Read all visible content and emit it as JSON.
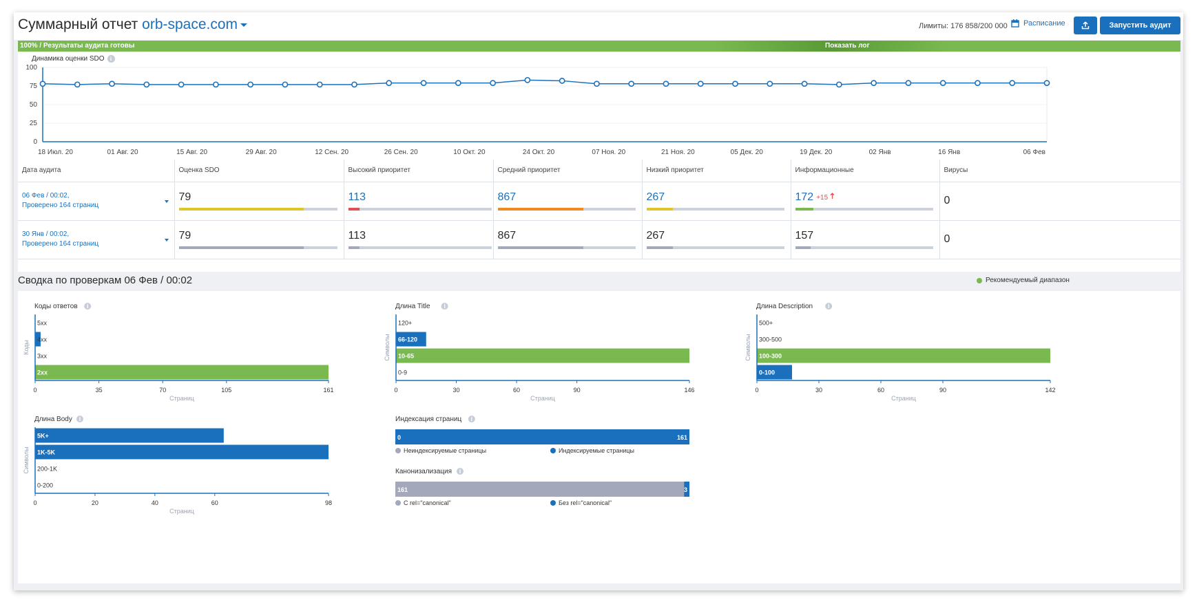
{
  "header": {
    "title": "Суммарный отчет",
    "domain": "orb-space.com",
    "limits": "Лимиты: 176 858/200 000",
    "schedule": "Расписание",
    "run_button": "Запустить аудит"
  },
  "progress": {
    "status": "100% / Результаты аудита готовы",
    "show_log": "Показать лог",
    "percent": 100
  },
  "colors": {
    "accent": "#1a70bd",
    "green": "#7ab94f",
    "yellow": "#e2c52a",
    "red": "#e05050",
    "orange": "#f08a1c",
    "grey": "#a3a9bb"
  },
  "sdo_chart": {
    "title": "Динамика оценки SDO",
    "y_ticks": [
      "100",
      "75",
      "50",
      "25",
      "0"
    ],
    "x_labels": [
      "18 Июл. 20",
      "01 Авг. 20",
      "15 Авг. 20",
      "29 Авг. 20",
      "12 Сен. 20",
      "26 Сен. 20",
      "10 Окт. 20",
      "24 Окт. 20",
      "07 Ноя. 20",
      "21 Ноя. 20",
      "05 Дек. 20",
      "19 Дек. 20",
      "02 Янв",
      "16 Янв",
      "06 Фев"
    ]
  },
  "audit_table": {
    "headers": [
      "Дата аудита",
      "Оценка SDO",
      "Высокий приоритет",
      "Средний приоритет",
      "Низкий приоритет",
      "Информационные",
      "Вирусы"
    ],
    "rows": [
      {
        "date_line1": "06 Фев / 00:02,",
        "date_line2": "Проверено 164 страниц",
        "sdo": "79",
        "high": "113",
        "medium": "867",
        "low": "267",
        "info": "172",
        "info_delta": "+15",
        "viruses": "0"
      },
      {
        "date_line1": "30 Янв / 00:02,",
        "date_line2": "Проверено 164 страниц",
        "sdo": "79",
        "high": "113",
        "medium": "867",
        "low": "267",
        "info": "157",
        "viruses": "0"
      }
    ]
  },
  "summary": {
    "title": "Сводка по проверкам 06 Фев / 00:02",
    "legend": "Рекомендуемый диапазон"
  },
  "chart_data": [
    {
      "type": "line",
      "title": "Динамика оценки SDO",
      "ylim": [
        0,
        100
      ],
      "x": [
        "18 Июл. 20",
        "",
        "01 Авг. 20",
        "",
        "15 Авг. 20",
        "",
        "29 Авг. 20",
        "",
        "12 Сен. 20",
        "",
        "26 Сен. 20",
        "",
        "10 Окт. 20",
        "",
        "24 Окт. 20",
        "",
        "07 Ноя. 20",
        "",
        "21 Ноя. 20",
        "",
        "05 Дек. 20",
        "",
        "19 Дек. 20",
        "",
        "02 Янв",
        "",
        "16 Янв",
        "",
        "",
        "06 Фев"
      ],
      "values": [
        78,
        77,
        78,
        77,
        77,
        77,
        77,
        77,
        77,
        77,
        79,
        79,
        79,
        79,
        83,
        82,
        78,
        78,
        78,
        78,
        78,
        78,
        78,
        77,
        79,
        79,
        79,
        79,
        79,
        79
      ]
    },
    {
      "type": "bar",
      "title": "Коды ответов",
      "ylabel": "Коды",
      "xlabel": "Страниц",
      "categories": [
        "5xx",
        "4xx",
        "3xx",
        "2xx"
      ],
      "values": [
        0,
        3,
        0,
        161
      ],
      "xticks": [
        "0",
        "35",
        "70",
        "105",
        "161"
      ],
      "xlim": [
        0,
        161
      ],
      "recommended": "2xx"
    },
    {
      "type": "bar",
      "title": "Длина Title",
      "ylabel": "Символы",
      "xlabel": "Страниц",
      "categories": [
        "120+",
        "66-120",
        "10-65",
        "0-9"
      ],
      "values": [
        0,
        15,
        146,
        0
      ],
      "xticks": [
        "0",
        "30",
        "60",
        "90",
        "146"
      ],
      "xlim": [
        0,
        146
      ],
      "recommended": "10-65"
    },
    {
      "type": "bar",
      "title": "Длина Description",
      "ylabel": "Символы",
      "xlabel": "Страниц",
      "categories": [
        "500+",
        "300-500",
        "100-300",
        "0-100"
      ],
      "values": [
        0,
        0,
        142,
        17
      ],
      "xticks": [
        "0",
        "30",
        "60",
        "90",
        "142"
      ],
      "xlim": [
        0,
        142
      ],
      "recommended": "100-300"
    },
    {
      "type": "bar",
      "title": "Длина Body",
      "ylabel": "Символы",
      "xlabel": "Страниц",
      "categories": [
        "5K+",
        "1K-5K",
        "200-1K",
        "0-200"
      ],
      "values": [
        63,
        98,
        0,
        0
      ],
      "xticks": [
        "0",
        "20",
        "40",
        "60",
        "98"
      ],
      "xlim": [
        0,
        98
      ]
    },
    {
      "type": "bar",
      "title": "Индексация страниц",
      "series": [
        {
          "name": "Неиндексируемые страницы",
          "values": [
            0
          ]
        },
        {
          "name": "Индексируемые страницы",
          "values": [
            161
          ]
        }
      ]
    },
    {
      "type": "bar",
      "title": "Канонизализация",
      "series": [
        {
          "name": "С rel=\"canonical\"",
          "values": [
            161
          ]
        },
        {
          "name": "Без rel=\"canonical\"",
          "values": [
            3
          ]
        }
      ]
    }
  ]
}
